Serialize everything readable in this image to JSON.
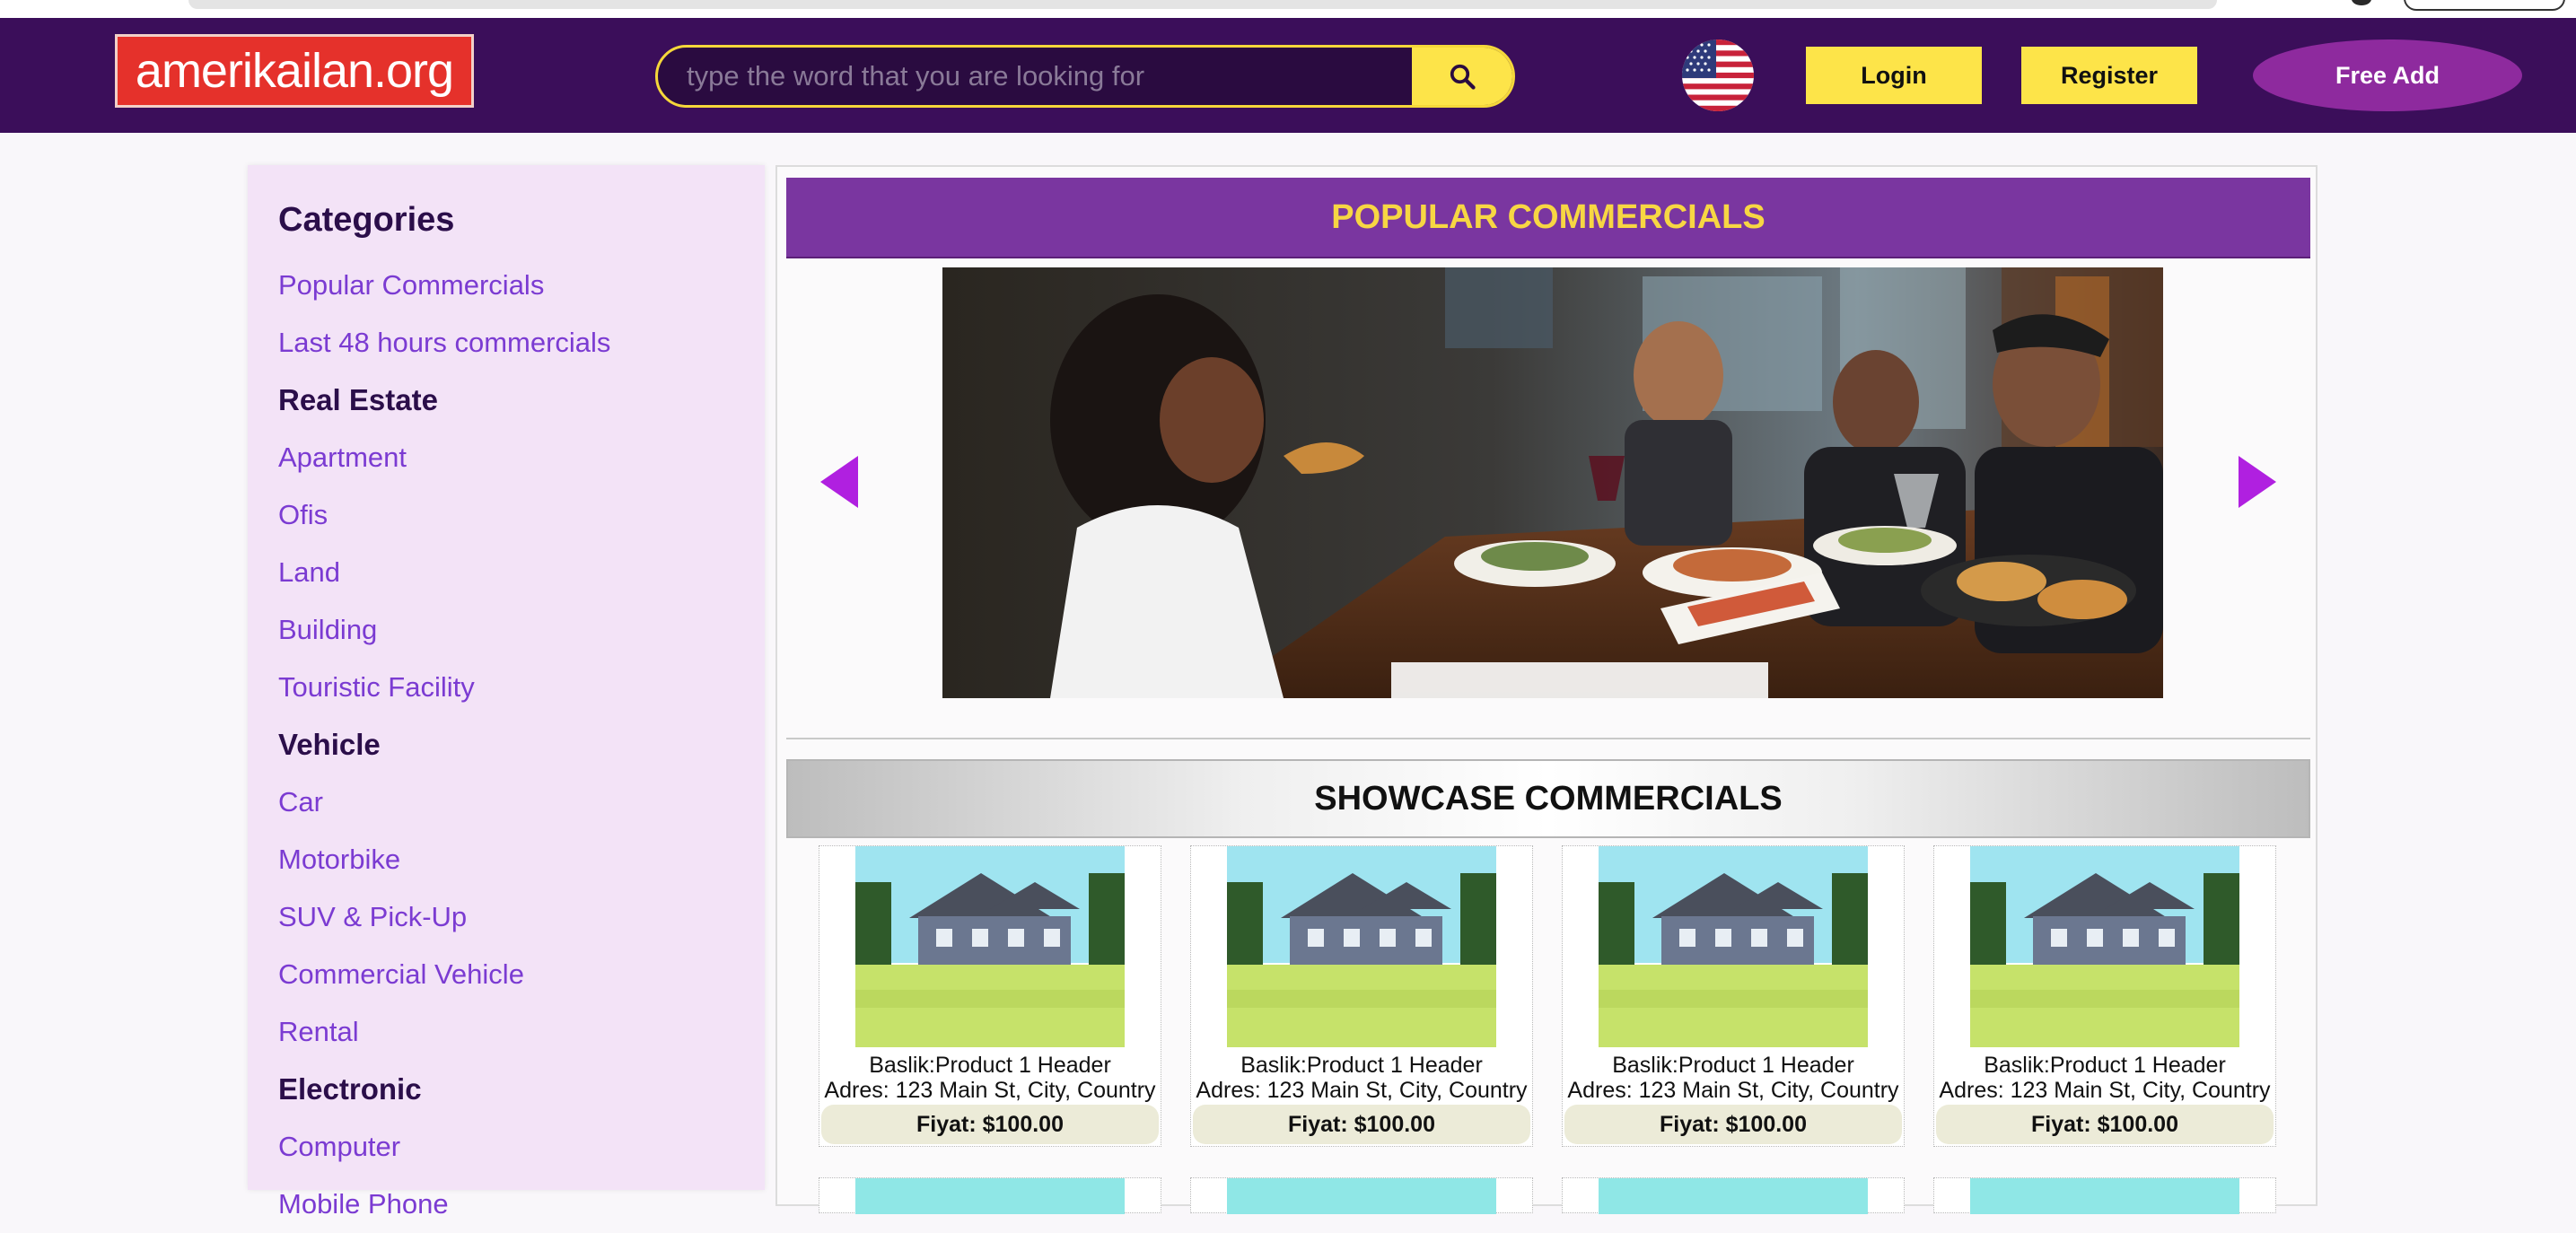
{
  "header": {
    "logo_text": "amerikailan.org",
    "search_placeholder": "type the word that you are looking for",
    "search_icon": "search-icon",
    "language_flag": "us-flag-icon",
    "login_label": "Login",
    "register_label": "Register",
    "free_add_label": "Free Add",
    "colors": {
      "header_bg": "#3b0e5a",
      "accent_yellow": "#fde449",
      "logo_red": "#e5312b",
      "free_add_purple": "#8e2a9e"
    }
  },
  "sidebar": {
    "title": "Categories",
    "items": [
      {
        "label": "Popular Commercials",
        "heading": false
      },
      {
        "label": "Last 48 hours commercials",
        "heading": false
      },
      {
        "label": "Real Estate",
        "heading": true
      },
      {
        "label": "Apartment",
        "heading": false
      },
      {
        "label": "Ofis",
        "heading": false
      },
      {
        "label": "Land",
        "heading": false
      },
      {
        "label": "Building",
        "heading": false
      },
      {
        "label": "Touristic Facility",
        "heading": false
      },
      {
        "label": "Vehicle",
        "heading": true
      },
      {
        "label": "Car",
        "heading": false
      },
      {
        "label": "Motorbike",
        "heading": false
      },
      {
        "label": "SUV & Pick-Up",
        "heading": false
      },
      {
        "label": "Commercial Vehicle",
        "heading": false
      },
      {
        "label": "Rental",
        "heading": false
      },
      {
        "label": "Electronic",
        "heading": true
      },
      {
        "label": "Computer",
        "heading": false
      },
      {
        "label": "Mobile Phone",
        "heading": false
      }
    ]
  },
  "main": {
    "popular_title": "POPULAR COMMERCIALS",
    "slider_prev_icon": "triangle-left-icon",
    "slider_next_icon": "triangle-right-icon",
    "showcase_title": "SHOWCASE COMMERCIALS",
    "products": [
      {
        "title": "Baslik:Product 1 Header",
        "address": "Adres: 123 Main St, City, Country",
        "price": "Fiyat: $100.00"
      },
      {
        "title": "Baslik:Product 1 Header",
        "address": "Adres: 123 Main St, City, Country",
        "price": "Fiyat: $100.00"
      },
      {
        "title": "Baslik:Product 1 Header",
        "address": "Adres: 123 Main St, City, Country",
        "price": "Fiyat: $100.00"
      },
      {
        "title": "Baslik:Product 1 Header",
        "address": "Adres: 123 Main St, City, Country",
        "price": "Fiyat: $100.00"
      }
    ]
  }
}
